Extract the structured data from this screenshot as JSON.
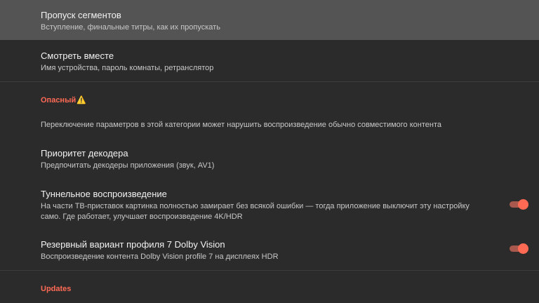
{
  "colors": {
    "background": "#2b2b2b",
    "focused_row": "#545454",
    "accent": "#ff6a55",
    "category_text": "#ff6a55"
  },
  "settings": {
    "segments": {
      "title": "Пропуск сегментов",
      "subtitle": "Вступление, финальные титры, как их пропускать"
    },
    "watch_together": {
      "title": "Смотреть вместе",
      "subtitle": "Имя устройства, пароль комнаты, ретранслятор"
    },
    "danger_category": {
      "label": "Опасный",
      "icon": "warning-icon",
      "glyph": "⚠️"
    },
    "danger_note": "Переключение параметров в этой категории может нарушить воспроизведение обычно совместимого контента",
    "decoder_priority": {
      "title": "Приоритет декодера",
      "subtitle": "Предпочитать декодеры приложения (звук, AV1)"
    },
    "tunneling": {
      "title": "Туннельное воспроизведение",
      "subtitle": "На части ТВ-приставок картинка полностью замирает без всякой ошибки — тогда приложение выключит эту настройку само. Где работает, улучшает воспроизведение 4K/HDR",
      "enabled": true
    },
    "dolby_vision": {
      "title": "Резервный вариант профиля 7 Dolby Vision",
      "subtitle": "Воспроизведение контента Dolby Vision profile 7 на дисплеях HDR",
      "enabled": true
    },
    "updates_category": {
      "label": "Updates"
    }
  }
}
